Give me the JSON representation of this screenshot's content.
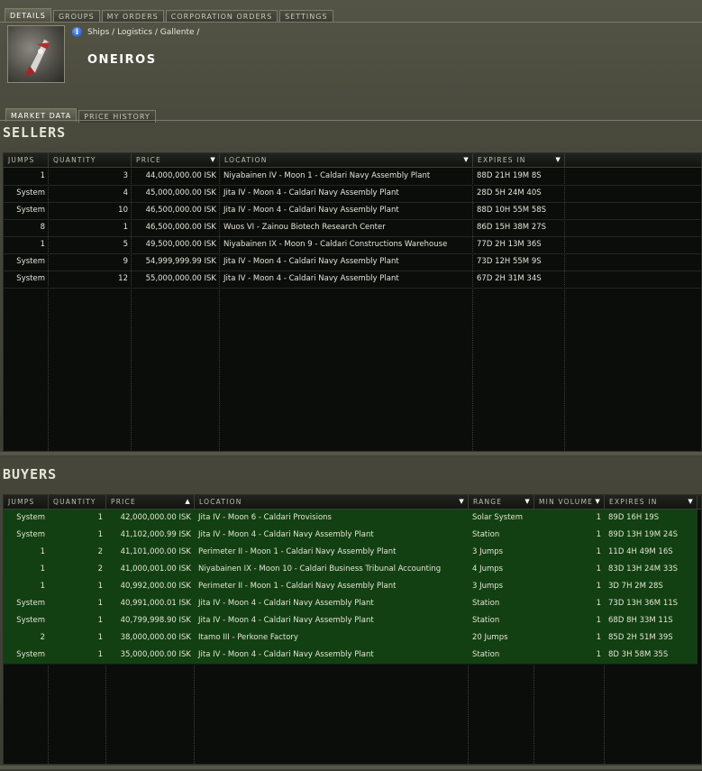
{
  "tabs": [
    "DETAILS",
    "GROUPS",
    "MY ORDERS",
    "CORPORATION ORDERS",
    "SETTINGS"
  ],
  "breadcrumb": "Ships / Logistics / Gallente /",
  "item_name": "ONEIROS",
  "subtabs": [
    "MARKET DATA",
    "PRICE HISTORY"
  ],
  "sellers": {
    "title": "SELLERS",
    "headers": [
      "JUMPS",
      "QUANTITY",
      "PRICE",
      "LOCATION",
      "EXPIRES IN"
    ],
    "rows": [
      {
        "jumps": "1",
        "qty": "3",
        "price": "44,000,000.00 ISK",
        "location": "Niyabainen IV - Moon 1 - Caldari Navy Assembly Plant",
        "expires": "88D 21H 19M 8S"
      },
      {
        "jumps": "System",
        "qty": "4",
        "price": "45,000,000.00 ISK",
        "location": "Jita IV - Moon 4 - Caldari Navy Assembly Plant",
        "expires": "28D 5H 24M 40S"
      },
      {
        "jumps": "System",
        "qty": "10",
        "price": "46,500,000.00 ISK",
        "location": "Jita IV - Moon 4 - Caldari Navy Assembly Plant",
        "expires": "88D 10H 55M 58S"
      },
      {
        "jumps": "8",
        "qty": "1",
        "price": "46,500,000.00 ISK",
        "location": "Wuos VI - Zainou Biotech Research Center",
        "expires": "86D 15H 38M 27S"
      },
      {
        "jumps": "1",
        "qty": "5",
        "price": "49,500,000.00 ISK",
        "location": "Niyabainen IX - Moon 9 - Caldari Constructions Warehouse",
        "expires": "77D 2H 13M 36S"
      },
      {
        "jumps": "System",
        "qty": "9",
        "price": "54,999,999.99 ISK",
        "location": "Jita IV - Moon 4 - Caldari Navy Assembly Plant",
        "expires": "73D 12H 55M 9S"
      },
      {
        "jumps": "System",
        "qty": "12",
        "price": "55,000,000.00 ISK",
        "location": "Jita IV - Moon 4 - Caldari Navy Assembly Plant",
        "expires": "67D 2H 31M 34S"
      }
    ]
  },
  "buyers": {
    "title": "BUYERS",
    "headers": [
      "JUMPS",
      "QUANTITY",
      "PRICE",
      "LOCATION",
      "RANGE",
      "MIN VOLUME",
      "EXPIRES IN"
    ],
    "rows": [
      {
        "jumps": "System",
        "qty": "1",
        "price": "42,000,000.00 ISK",
        "location": "Jita IV - Moon 6 - Caldari Provisions",
        "range": "Solar System",
        "minvol": "1",
        "expires": "89D 16H 19S"
      },
      {
        "jumps": "System",
        "qty": "1",
        "price": "41,102,000.99 ISK",
        "location": "Jita IV - Moon 4 - Caldari Navy Assembly Plant",
        "range": "Station",
        "minvol": "1",
        "expires": "89D 13H 19M 24S"
      },
      {
        "jumps": "1",
        "qty": "2",
        "price": "41,101,000.00 ISK",
        "location": "Perimeter II - Moon 1 - Caldari Navy Assembly Plant",
        "range": "3 Jumps",
        "minvol": "1",
        "expires": "11D 4H 49M 16S"
      },
      {
        "jumps": "1",
        "qty": "2",
        "price": "41,000,001.00 ISK",
        "location": "Niyabainen IX - Moon 10 - Caldari Business Tribunal Accounting",
        "range": "4 Jumps",
        "minvol": "1",
        "expires": "83D 13H 24M 33S"
      },
      {
        "jumps": "1",
        "qty": "1",
        "price": "40,992,000.00 ISK",
        "location": "Perimeter II - Moon 1 - Caldari Navy Assembly Plant",
        "range": "3 Jumps",
        "minvol": "1",
        "expires": "3D 7H 2M 28S"
      },
      {
        "jumps": "System",
        "qty": "1",
        "price": "40,991,000.01 ISK",
        "location": "Jita IV - Moon 4 - Caldari Navy Assembly Plant",
        "range": "Station",
        "minvol": "1",
        "expires": "73D 13H 36M 11S"
      },
      {
        "jumps": "System",
        "qty": "1",
        "price": "40,799,998.90 ISK",
        "location": "Jita IV - Moon 4 - Caldari Navy Assembly Plant",
        "range": "Station",
        "minvol": "1",
        "expires": "68D 8H 33M 11S"
      },
      {
        "jumps": "2",
        "qty": "1",
        "price": "38,000,000.00 ISK",
        "location": "Itamo III - Perkone Factory",
        "range": "20 Jumps",
        "minvol": "1",
        "expires": "85D 2H 51M 39S"
      },
      {
        "jumps": "System",
        "qty": "1",
        "price": "35,000,000.00 ISK",
        "location": "Jita IV - Moon 4 - Caldari Navy Assembly Plant",
        "range": "Station",
        "minvol": "1",
        "expires": "8D 3H 58M 35S"
      }
    ]
  },
  "colors": {
    "buyer_row": "#124012",
    "panel_bg": "#0b0d0b"
  }
}
